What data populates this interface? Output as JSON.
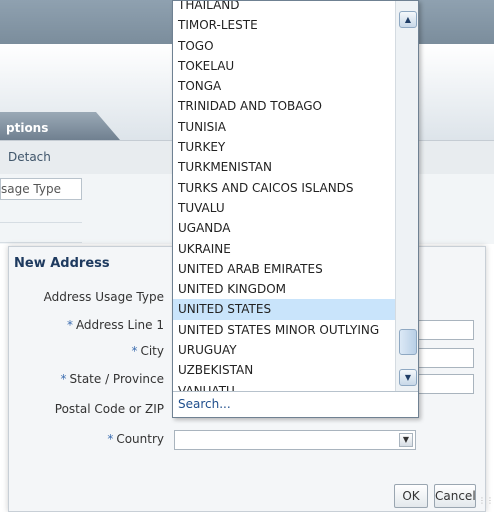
{
  "background": {
    "tab_label": "ptions",
    "detach_label": "Detach",
    "column_header": "sage Type"
  },
  "dialog": {
    "title": "New Address",
    "fields": {
      "address_usage_type": {
        "label": "Address Usage Type",
        "required": ""
      },
      "address_line_1": {
        "label": "Address Line 1",
        "required": "*",
        "value": ""
      },
      "city": {
        "label": "City",
        "required": "*",
        "value": ""
      },
      "state_province": {
        "label": "State / Province",
        "required": "*",
        "value": ""
      },
      "postal_code": {
        "label": "Postal Code or ZIP",
        "required": "",
        "value": ""
      },
      "country": {
        "label": "Country",
        "required": "*",
        "value": ""
      }
    },
    "ok_label": "OK",
    "cancel_label": "Cancel"
  },
  "country_dropdown": {
    "options": [
      "THAILAND",
      "TIMOR-LESTE",
      "TOGO",
      "TOKELAU",
      "TONGA",
      "TRINIDAD AND TOBAGO",
      "TUNISIA",
      "TURKEY",
      "TURKMENISTAN",
      "TURKS AND CAICOS ISLANDS",
      "TUVALU",
      "UGANDA",
      "UKRAINE",
      "UNITED ARAB EMIRATES",
      "UNITED KINGDOM",
      "UNITED STATES",
      "UNITED STATES MINOR OUTLYING",
      "URUGUAY",
      "UZBEKISTAN",
      "VANUATU"
    ],
    "selected": "UNITED STATES",
    "search_label": "Search..."
  },
  "icons": {
    "scroll_up": "chevron-up-icon",
    "scroll_down": "chevron-down-icon",
    "select_arrow": "caret-down-icon",
    "resize_grip": "resize-grip-icon"
  },
  "colors": {
    "selected_row": "#c9e4fb",
    "required_marker": "#3b6db0",
    "dialog_title": "#1e3a5f",
    "link": "#1f4e8c"
  }
}
